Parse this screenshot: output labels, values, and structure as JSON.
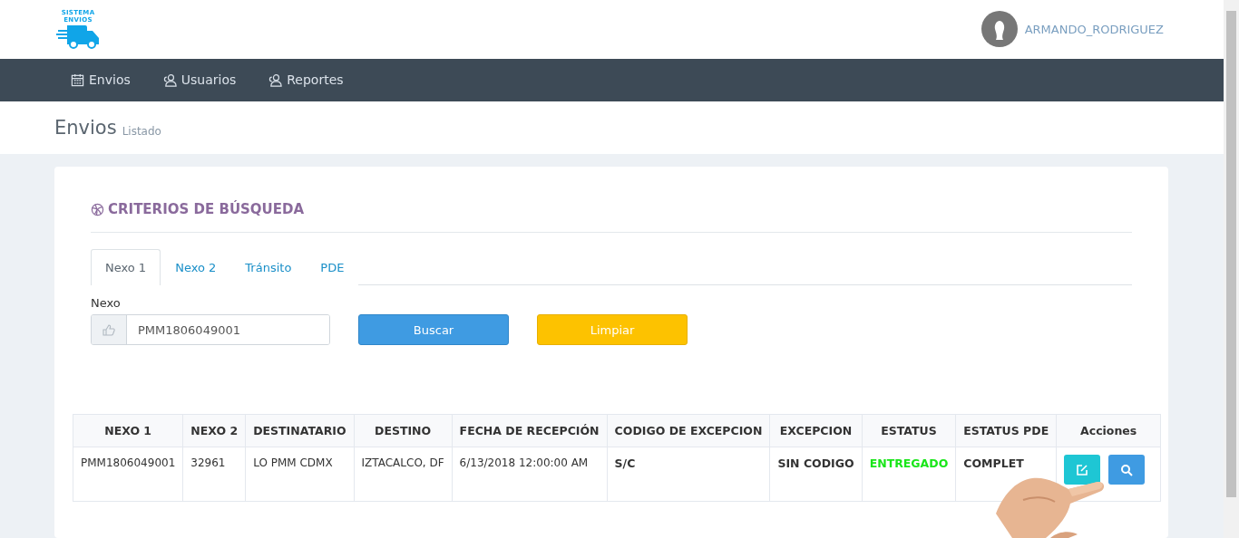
{
  "logo": {
    "line1": "SISTEMA",
    "line2": "ENVIOS"
  },
  "user": {
    "name": "ARMANDO_RODRIGUEZ"
  },
  "nav": [
    {
      "label": "Envios",
      "kind": "calendar"
    },
    {
      "label": "Usuarios",
      "kind": "users"
    },
    {
      "label": "Reportes",
      "kind": "users"
    }
  ],
  "page": {
    "title": "Envios",
    "subtitle": "Listado"
  },
  "search": {
    "title": "CRITERIOS DE BÚSQUEDA",
    "tabs": [
      {
        "label": "Nexo 1",
        "selected": true
      },
      {
        "label": "Nexo 2",
        "selected": false
      },
      {
        "label": "Tránsito",
        "selected": false
      },
      {
        "label": "PDE",
        "selected": false
      }
    ],
    "field": {
      "label": "Nexo",
      "value": "PMM1806049001"
    },
    "buttons": [
      {
        "label": "Buscar",
        "kind": "primary"
      },
      {
        "label": "Limpiar",
        "kind": "warning"
      }
    ]
  },
  "table": {
    "columns": [
      "NEXO 1",
      "NEXO 2",
      "DESTINATARIO",
      "DESTINO",
      "FECHA DE RECEPCIÓN",
      "CODIGO DE EXCEPCION",
      "EXCEPCION",
      "ESTATUS",
      "ESTATUS PDE",
      "Acciones"
    ],
    "rows": [
      {
        "cells": [
          {
            "text": "PMM1806049001",
            "kind": "plain"
          },
          {
            "text": "32961",
            "kind": "plain"
          },
          {
            "text": "LO PMM CDMX",
            "kind": "plain"
          },
          {
            "text": "IZTACALCO, DF",
            "kind": "plain"
          },
          {
            "text": "6/13/2018 12:00:00 AM",
            "kind": "plain"
          },
          {
            "text": "S/C",
            "kind": "bold"
          },
          {
            "text": "SIN CODIGO",
            "kind": "bold"
          },
          {
            "text": "ENTREGADO",
            "kind": "success"
          },
          {
            "text": "COMPLET",
            "kind": "bold"
          }
        ]
      }
    ]
  }
}
